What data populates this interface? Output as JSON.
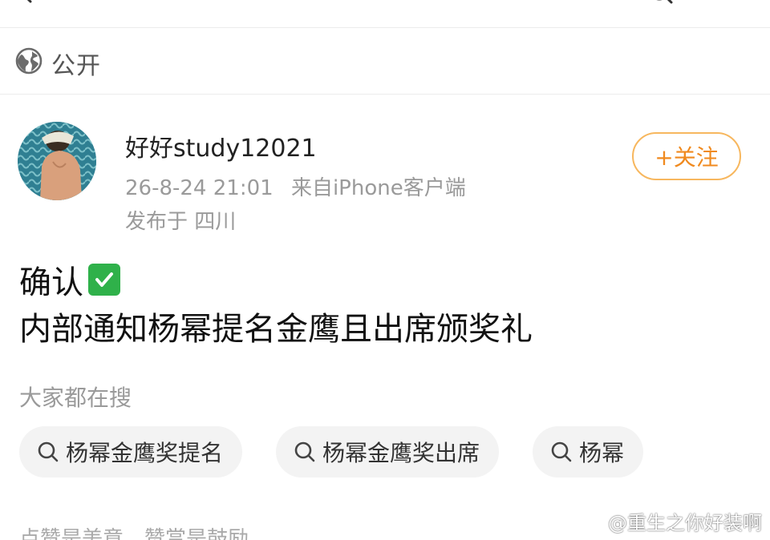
{
  "visibility": {
    "label": "公开"
  },
  "post": {
    "username": "好好study12021",
    "time": "26-8-24 21:01",
    "source": "来自iPhone客户端",
    "location": "发布于 四川",
    "follow_label": "+关注",
    "line1": "确认",
    "line2": "内部通知杨幂提名金鹰且出席颁奖礼"
  },
  "hot_search": {
    "label": "大家都在搜",
    "chips": [
      "杨幂金鹰奖提名",
      "杨幂金鹰奖出席",
      "杨幂"
    ]
  },
  "bottom_text": "点赞是美意，赞赏是鼓励",
  "watermark": "@重生之你好装啊",
  "colors": {
    "accent": "#f08a1f",
    "accent_border": "#f7b75e",
    "check_green": "#2fb14a"
  },
  "icons": [
    "back-icon",
    "search-icon",
    "globe-icon",
    "check-mark-icon",
    "weibo-logo-icon"
  ]
}
